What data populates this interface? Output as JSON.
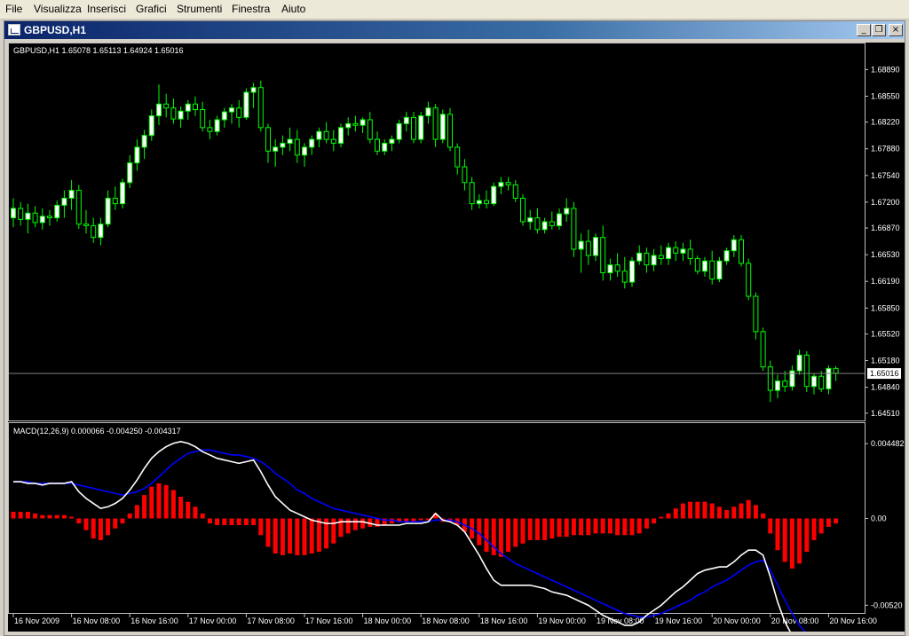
{
  "menu": [
    "File",
    "Visualizza",
    "Inserisci",
    "Grafici",
    "Strumenti",
    "Finestra",
    "Aiuto"
  ],
  "window": {
    "title": "GBPUSD,H1",
    "minimize": "_",
    "restore": "❐",
    "close": "×"
  },
  "colors": {
    "background": "#000000",
    "bull": "#ffffff",
    "bear": "#000000",
    "wick": "#00ff00",
    "histogram": "#ff0000",
    "macd_line": "#ffffff",
    "signal_line": "#0000ff",
    "text": "#ffffff"
  },
  "main_label": "GBPUSD,H1  1.65078 1.65113 1.64924 1.65016",
  "macd_label": "MACD(12,26,9) 0.000066 -0.004250 -0.004317",
  "chart_data": [
    {
      "type": "candlestick",
      "title": "GBPUSD,H1",
      "ylim": [
        1.6444,
        1.6903
      ],
      "y_ticks": [
        "1.68890",
        "1.68550",
        "1.68220",
        "1.67880",
        "1.67540",
        "1.67200",
        "1.66870",
        "1.66530",
        "1.66190",
        "1.65850",
        "1.65520",
        "1.65180",
        "1.64840",
        "1.64510"
      ],
      "current_price": "1.65016",
      "current_price_value": 1.65016,
      "candles": [
        [
          1.67,
          1.6725,
          1.6688,
          1.6712
        ],
        [
          1.6712,
          1.672,
          1.669,
          1.6698
        ],
        [
          1.6698,
          1.6718,
          1.668,
          1.6706
        ],
        [
          1.6706,
          1.6715,
          1.6688,
          1.6694
        ],
        [
          1.6694,
          1.6712,
          1.6685,
          1.6702
        ],
        [
          1.6702,
          1.671,
          1.669,
          1.67
        ],
        [
          1.67,
          1.6722,
          1.6695,
          1.6716
        ],
        [
          1.6716,
          1.6735,
          1.67,
          1.6725
        ],
        [
          1.6725,
          1.6748,
          1.671,
          1.6735
        ],
        [
          1.6735,
          1.6742,
          1.6686,
          1.6692
        ],
        [
          1.6692,
          1.671,
          1.668,
          1.669
        ],
        [
          1.669,
          1.67,
          1.6668,
          1.6675
        ],
        [
          1.6675,
          1.67,
          1.6665,
          1.6692
        ],
        [
          1.6692,
          1.6735,
          1.6688,
          1.6725
        ],
        [
          1.6725,
          1.674,
          1.671,
          1.6718
        ],
        [
          1.6718,
          1.675,
          1.6712,
          1.6745
        ],
        [
          1.6745,
          1.678,
          1.6738,
          1.677
        ],
        [
          1.677,
          1.68,
          1.676,
          1.679
        ],
        [
          1.679,
          1.6812,
          1.6775,
          1.6805
        ],
        [
          1.6805,
          1.6838,
          1.6798,
          1.683
        ],
        [
          1.683,
          1.687,
          1.6818,
          1.6845
        ],
        [
          1.6845,
          1.6858,
          1.6828,
          1.684
        ],
        [
          1.684,
          1.6852,
          1.682,
          1.6826
        ],
        [
          1.6826,
          1.6842,
          1.6815,
          1.6836
        ],
        [
          1.6836,
          1.685,
          1.6825,
          1.6845
        ],
        [
          1.6845,
          1.6855,
          1.683,
          1.6838
        ],
        [
          1.6838,
          1.6848,
          1.681,
          1.6815
        ],
        [
          1.6815,
          1.6825,
          1.68,
          1.681
        ],
        [
          1.681,
          1.683,
          1.6805,
          1.6825
        ],
        [
          1.6825,
          1.684,
          1.6815,
          1.6835
        ],
        [
          1.6835,
          1.6845,
          1.682,
          1.684
        ],
        [
          1.684,
          1.685,
          1.6815,
          1.6828
        ],
        [
          1.6828,
          1.6865,
          1.6825,
          1.686
        ],
        [
          1.686,
          1.6872,
          1.684,
          1.6866
        ],
        [
          1.6866,
          1.6875,
          1.681,
          1.6815
        ],
        [
          1.6815,
          1.682,
          1.677,
          1.6785
        ],
        [
          1.6785,
          1.68,
          1.6765,
          1.679
        ],
        [
          1.679,
          1.6805,
          1.678,
          1.6795
        ],
        [
          1.6795,
          1.6815,
          1.6785,
          1.68
        ],
        [
          1.68,
          1.6812,
          1.677,
          1.678
        ],
        [
          1.678,
          1.6795,
          1.6765,
          1.679
        ],
        [
          1.679,
          1.6805,
          1.678,
          1.68
        ],
        [
          1.68,
          1.6815,
          1.679,
          1.681
        ],
        [
          1.681,
          1.6822,
          1.6795,
          1.68
        ],
        [
          1.68,
          1.6812,
          1.6785,
          1.6795
        ],
        [
          1.6795,
          1.682,
          1.679,
          1.6815
        ],
        [
          1.6815,
          1.6828,
          1.6805,
          1.682
        ],
        [
          1.682,
          1.683,
          1.681,
          1.6818
        ],
        [
          1.6818,
          1.6828,
          1.6808,
          1.6825
        ],
        [
          1.6825,
          1.6835,
          1.6795,
          1.68
        ],
        [
          1.68,
          1.681,
          1.678,
          1.6785
        ],
        [
          1.6785,
          1.68,
          1.678,
          1.6795
        ],
        [
          1.6795,
          1.6805,
          1.6785,
          1.68
        ],
        [
          1.68,
          1.6825,
          1.6795,
          1.682
        ],
        [
          1.682,
          1.6835,
          1.681,
          1.6828
        ],
        [
          1.6828,
          1.6835,
          1.6795,
          1.68
        ],
        [
          1.68,
          1.6835,
          1.6795,
          1.683
        ],
        [
          1.683,
          1.6848,
          1.682,
          1.684
        ],
        [
          1.684,
          1.6845,
          1.679,
          1.68
        ],
        [
          1.68,
          1.6838,
          1.6795,
          1.6832
        ],
        [
          1.6832,
          1.684,
          1.6785,
          1.679
        ],
        [
          1.679,
          1.6795,
          1.6755,
          1.6765
        ],
        [
          1.6765,
          1.6775,
          1.6735,
          1.6745
        ],
        [
          1.6745,
          1.6752,
          1.671,
          1.6718
        ],
        [
          1.6718,
          1.673,
          1.6712,
          1.6722
        ],
        [
          1.6722,
          1.6735,
          1.6712,
          1.6718
        ],
        [
          1.6718,
          1.6745,
          1.6715,
          1.674
        ],
        [
          1.674,
          1.6752,
          1.673,
          1.6745
        ],
        [
          1.6745,
          1.6752,
          1.6735,
          1.6742
        ],
        [
          1.6742,
          1.6748,
          1.672,
          1.6725
        ],
        [
          1.6725,
          1.673,
          1.669,
          1.6695
        ],
        [
          1.6695,
          1.671,
          1.6685,
          1.67
        ],
        [
          1.67,
          1.6712,
          1.668,
          1.6685
        ],
        [
          1.6685,
          1.67,
          1.668,
          1.6695
        ],
        [
          1.6695,
          1.6708,
          1.6685,
          1.669
        ],
        [
          1.669,
          1.6712,
          1.6685,
          1.6705
        ],
        [
          1.6705,
          1.6725,
          1.6695,
          1.6712
        ],
        [
          1.6712,
          1.672,
          1.665,
          1.666
        ],
        [
          1.666,
          1.668,
          1.663,
          1.667
        ],
        [
          1.667,
          1.6685,
          1.664,
          1.6652
        ],
        [
          1.6652,
          1.668,
          1.6645,
          1.6675
        ],
        [
          1.6675,
          1.669,
          1.662,
          1.663
        ],
        [
          1.663,
          1.6648,
          1.662,
          1.664
        ],
        [
          1.664,
          1.6655,
          1.6625,
          1.6632
        ],
        [
          1.6632,
          1.665,
          1.661,
          1.6618
        ],
        [
          1.6618,
          1.665,
          1.6612,
          1.6645
        ],
        [
          1.6645,
          1.6665,
          1.664,
          1.6655
        ],
        [
          1.6655,
          1.6662,
          1.663,
          1.664
        ],
        [
          1.664,
          1.666,
          1.6632,
          1.6652
        ],
        [
          1.6652,
          1.6665,
          1.664,
          1.6648
        ],
        [
          1.6648,
          1.6668,
          1.664,
          1.6662
        ],
        [
          1.6662,
          1.667,
          1.6645,
          1.6655
        ],
        [
          1.6655,
          1.6668,
          1.6645,
          1.666
        ],
        [
          1.666,
          1.6672,
          1.664,
          1.6648
        ],
        [
          1.6648,
          1.6652,
          1.6628,
          1.6632
        ],
        [
          1.6632,
          1.665,
          1.6625,
          1.6645
        ],
        [
          1.6645,
          1.6658,
          1.6615,
          1.6622
        ],
        [
          1.6622,
          1.665,
          1.6618,
          1.6645
        ],
        [
          1.6645,
          1.6662,
          1.664,
          1.6658
        ],
        [
          1.6658,
          1.6678,
          1.665,
          1.6672
        ],
        [
          1.6672,
          1.6678,
          1.6638,
          1.6642
        ],
        [
          1.6642,
          1.6648,
          1.6595,
          1.66
        ],
        [
          1.66,
          1.6605,
          1.6545,
          1.6555
        ],
        [
          1.6555,
          1.656,
          1.6505,
          1.651
        ],
        [
          1.651,
          1.6518,
          1.6465,
          1.648
        ],
        [
          1.648,
          1.65,
          1.647,
          1.6492
        ],
        [
          1.6492,
          1.6505,
          1.6478,
          1.6485
        ],
        [
          1.6485,
          1.6512,
          1.648,
          1.6505
        ],
        [
          1.6505,
          1.6532,
          1.65,
          1.6525
        ],
        [
          1.6525,
          1.653,
          1.6478,
          1.6485
        ],
        [
          1.6485,
          1.6502,
          1.6475,
          1.6498
        ],
        [
          1.6498,
          1.6505,
          1.6478,
          1.6482
        ],
        [
          1.6482,
          1.6512,
          1.6475,
          1.6508
        ],
        [
          1.6508,
          1.6511,
          1.6492,
          1.6502
        ]
      ]
    },
    {
      "type": "bar+line",
      "title": "MACD(12,26,9)",
      "ylim": [
        -0.0055,
        0.0047
      ],
      "y_ticks": [
        "0.004482",
        "0.00",
        "-0.00520"
      ],
      "x_ticks": [
        "16 Nov 2009",
        "16 Nov 08:00",
        "16 Nov 16:00",
        "17 Nov 00:00",
        "17 Nov 08:00",
        "17 Nov 16:00",
        "18 Nov 00:00",
        "18 Nov 08:00",
        "18 Nov 16:00",
        "19 Nov 00:00",
        "19 Nov 08:00",
        "19 Nov 16:00",
        "20 Nov 00:00",
        "20 Nov 08:00",
        "20 Nov 16:00"
      ],
      "histogram": [
        0.0004,
        0.0004,
        0.0004,
        0.0003,
        0.0002,
        0.0002,
        0.0002,
        0.0002,
        0.0001,
        -0.0003,
        -0.0007,
        -0.0012,
        -0.0013,
        -0.001,
        -0.0006,
        -0.0003,
        0.0003,
        0.0008,
        0.0014,
        0.0019,
        0.0021,
        0.002,
        0.0017,
        0.0013,
        0.001,
        0.0007,
        0.0003,
        -0.0003,
        -0.0004,
        -0.0004,
        -0.0004,
        -0.0004,
        -0.0004,
        -0.0004,
        -0.001,
        -0.0017,
        -0.0021,
        -0.0022,
        -0.0021,
        -0.0022,
        -0.0022,
        -0.0021,
        -0.002,
        -0.0018,
        -0.0015,
        -0.0011,
        -0.0009,
        -0.0007,
        -0.0006,
        -0.0005,
        -0.0005,
        -0.0004,
        -0.0003,
        -0.0002,
        -0.0002,
        -0.0002,
        -0.0001,
        -0.0001,
        0.0003,
        -0.0002,
        -0.0002,
        -0.0004,
        -0.0008,
        -0.0012,
        -0.0016,
        -0.002,
        -0.0022,
        -0.0023,
        -0.002,
        -0.0017,
        -0.0015,
        -0.0013,
        -0.0013,
        -0.0013,
        -0.0012,
        -0.0011,
        -0.0011,
        -0.001,
        -0.001,
        -0.001,
        -0.0009,
        -0.0009,
        -0.0009,
        -0.001,
        -0.001,
        -0.001,
        -0.0009,
        -0.0006,
        -0.0003,
        0.0001,
        0.0003,
        0.0006,
        0.0009,
        0.001,
        0.001,
        0.001,
        0.0009,
        0.0007,
        0.0005,
        0.0007,
        0.0009,
        0.0011,
        0.0008,
        0.0003,
        -0.0009,
        -0.0019,
        -0.0026,
        -0.003,
        -0.0027,
        -0.002,
        -0.0013,
        -0.0009,
        -0.0005,
        -0.0003
      ],
      "macd": [
        0.0022,
        0.0022,
        0.0021,
        0.0021,
        0.002,
        0.0021,
        0.0021,
        0.0021,
        0.0022,
        0.0016,
        0.0012,
        0.0009,
        0.0006,
        0.0007,
        0.0009,
        0.0012,
        0.0017,
        0.0023,
        0.003,
        0.0036,
        0.004,
        0.0043,
        0.0045,
        0.0046,
        0.0045,
        0.0043,
        0.004,
        0.0038,
        0.0036,
        0.0035,
        0.0034,
        0.0033,
        0.0034,
        0.0035,
        0.0028,
        0.002,
        0.0013,
        0.0009,
        0.0005,
        0.0003,
        0.0001,
        -0.0001,
        -0.0002,
        -0.0003,
        -0.0003,
        -0.0002,
        -0.0002,
        -0.0002,
        -0.0002,
        -0.0003,
        -0.0004,
        -0.0004,
        -0.0004,
        -0.0004,
        -0.0003,
        -0.0003,
        -0.0003,
        -0.0002,
        0.0003,
        -0.0001,
        -0.0002,
        -0.0004,
        -0.0008,
        -0.0015,
        -0.0022,
        -0.003,
        -0.0037,
        -0.004,
        -0.004,
        -0.004,
        -0.004,
        -0.004,
        -0.0041,
        -0.0042,
        -0.0044,
        -0.0045,
        -0.0046,
        -0.0048,
        -0.005,
        -0.0052,
        -0.0055,
        -0.0058,
        -0.006,
        -0.0062,
        -0.0064,
        -0.0064,
        -0.0062,
        -0.0058,
        -0.0055,
        -0.0052,
        -0.0048,
        -0.0044,
        -0.0041,
        -0.0037,
        -0.0033,
        -0.0031,
        -0.003,
        -0.0029,
        -0.0029,
        -0.0026,
        -0.0022,
        -0.0019,
        -0.0019,
        -0.0022,
        -0.0035,
        -0.005,
        -0.0062,
        -0.007,
        -0.0078,
        -0.008,
        -0.008,
        -0.0078,
        -0.0077,
        -0.0078,
        -0.0076,
        -0.0074,
        -0.0071
      ],
      "signal": [
        0.0022,
        0.0022,
        0.0022,
        0.0021,
        0.0021,
        0.0021,
        0.0021,
        0.0021,
        0.0021,
        0.002,
        0.0019,
        0.0018,
        0.0017,
        0.0016,
        0.0015,
        0.0014,
        0.0015,
        0.0016,
        0.0018,
        0.0021,
        0.0025,
        0.0029,
        0.0033,
        0.0036,
        0.0039,
        0.004,
        0.0041,
        0.0041,
        0.004,
        0.0039,
        0.0038,
        0.0038,
        0.0037,
        0.0036,
        0.0034,
        0.0031,
        0.0027,
        0.0024,
        0.0021,
        0.0017,
        0.0015,
        0.0012,
        0.001,
        0.0008,
        0.0006,
        0.0005,
        0.0004,
        0.0003,
        0.0002,
        0.0001,
        0.0,
        -0.0001,
        -0.0001,
        -0.0002,
        -0.0002,
        -0.0002,
        -0.0002,
        -0.0002,
        -0.0001,
        -0.0001,
        -0.0001,
        -0.0002,
        -0.0004,
        -0.0006,
        -0.0009,
        -0.0013,
        -0.0017,
        -0.0021,
        -0.0024,
        -0.0027,
        -0.0029,
        -0.0031,
        -0.0033,
        -0.0035,
        -0.0037,
        -0.0039,
        -0.0041,
        -0.0043,
        -0.0045,
        -0.0047,
        -0.0049,
        -0.0051,
        -0.0053,
        -0.0055,
        -0.0057,
        -0.0058,
        -0.0059,
        -0.0059,
        -0.0058,
        -0.0057,
        -0.0055,
        -0.0053,
        -0.0051,
        -0.0049,
        -0.0046,
        -0.0044,
        -0.0041,
        -0.0039,
        -0.0037,
        -0.0034,
        -0.0031,
        -0.0028,
        -0.0026,
        -0.0025,
        -0.0031,
        -0.004,
        -0.0049,
        -0.0057,
        -0.0064,
        -0.0069,
        -0.0072,
        -0.0074,
        -0.0075,
        -0.0076,
        -0.0075,
        -0.0074,
        -0.0073
      ]
    }
  ]
}
